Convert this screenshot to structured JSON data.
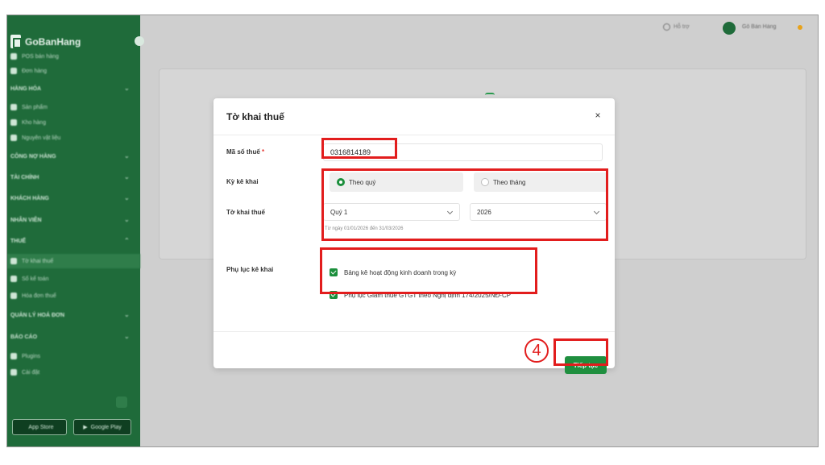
{
  "sidebar": {
    "brand": "GoBanHang",
    "items": [
      {
        "label": "POS bán hàng",
        "type": "item"
      },
      {
        "label": "Đơn hàng",
        "type": "item"
      },
      {
        "label": "HÀNG HÓA",
        "type": "group"
      },
      {
        "label": "Sản phẩm",
        "type": "item"
      },
      {
        "label": "Kho hàng",
        "type": "item"
      },
      {
        "label": "Nguyên vật liệu",
        "type": "item"
      },
      {
        "label": "CÔNG NỢ HÀNG",
        "type": "group"
      },
      {
        "label": "TÀI CHÍNH",
        "type": "group"
      },
      {
        "label": "KHÁCH HÀNG",
        "type": "group"
      },
      {
        "label": "NHÂN VIÊN",
        "type": "group"
      },
      {
        "label": "THUẾ",
        "type": "group"
      },
      {
        "label": "Tờ khai thuế",
        "type": "active"
      },
      {
        "label": "Sổ kế toán",
        "type": "item"
      },
      {
        "label": "Hóa đơn thuế",
        "type": "item"
      },
      {
        "label": "QUẢN LÝ HOÁ ĐƠN",
        "type": "group"
      },
      {
        "label": "BÁO CÁO",
        "type": "group"
      },
      {
        "label": "Plugins",
        "type": "item"
      },
      {
        "label": "Cài đặt",
        "type": "item"
      }
    ],
    "app_store": "App Store",
    "google_play": "Google Play"
  },
  "header": {
    "help_label": "Hỗ trợ",
    "user_name": "Gõ Bán Hàng"
  },
  "modal": {
    "title": "Tờ khai thuế",
    "close_label": "×",
    "tax_code_label": "Mã số thuế",
    "tax_code_required": "*",
    "tax_code_value": "0316814189",
    "period_label": "Kỳ kê khai",
    "period_quarter": "Theo quý",
    "period_month": "Theo tháng",
    "declaration_label": "Tờ khai thuế",
    "quarter_value": "Quý 1",
    "year_value": "2026",
    "date_hint": "Từ ngày 01/01/2026 đến 31/03/2026",
    "appendix_label": "Phụ lục kê khai",
    "appendix_1": "Bảng kê hoạt động kinh doanh trong kỳ",
    "appendix_2": "Phụ lục Giảm thuế GTGT theo Nghị định 174/2025/NĐ-CP",
    "next_button": "Tiếp tục"
  },
  "annotation": {
    "step_number": "4",
    "color": "#e21d1d"
  },
  "colors": {
    "sidebar": "#1f6b3a",
    "primary": "#1f8f3f",
    "overlay": "#cfcfcf"
  }
}
